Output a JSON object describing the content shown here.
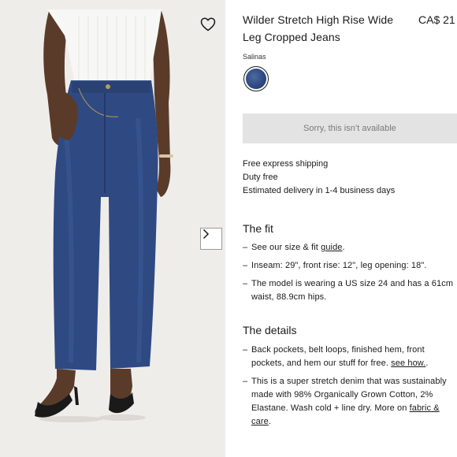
{
  "product": {
    "title": "Wilder Stretch High Rise Wide Leg Cropped Jeans",
    "price": "CA$ 21",
    "color_name": "Salinas",
    "swatch_color": "#2f4a82",
    "unavailable_label": "Sorry, this isn’t available"
  },
  "shipping": [
    "Free express shipping",
    "Duty free",
    "Estimated delivery in 1-4 business days"
  ],
  "fit": {
    "heading": "The fit",
    "b1_pre": "See our size & fit ",
    "b1_link": "guide",
    "b1_post": ".",
    "b2": "Inseam: 29\", front rise: 12\", leg opening: 18\".",
    "b3": "The model is wearing a US size 24 and has a 61cm waist, 88.9cm hips."
  },
  "details": {
    "heading": "The details",
    "b1_pre": "Back pockets, belt loops, finished hem, front pockets, and hem our stuff for free. ",
    "b1_link": "see how.",
    "b1_post": ".",
    "b2_pre": "This is a super stretch denim that was sustainably made with 98% Organically Grown Cotton, 2% Elastane. Wash cold + line dry. More on ",
    "b2_link": "fabric & care",
    "b2_post": "."
  },
  "colors": {
    "denim": "#2f4a82",
    "button_bg": "#e3e3e3",
    "button_text": "#7a7a7a"
  },
  "icons": {
    "wishlist": "heart-icon",
    "next": "chevron-right-icon"
  }
}
